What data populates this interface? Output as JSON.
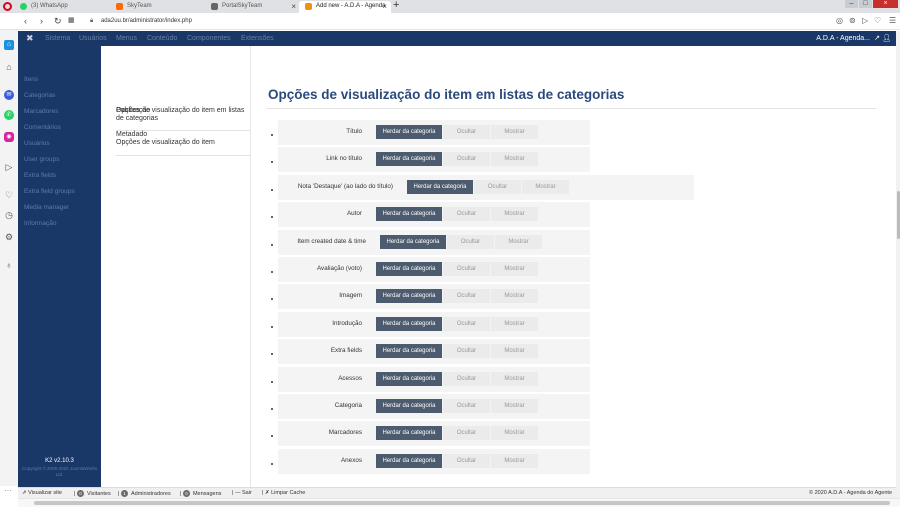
{
  "browser": {
    "tabs": [
      {
        "label": "(3) WhatsApp",
        "color": "#25d366",
        "active": false
      },
      {
        "label": "SkyTeam",
        "color": "#ff6a00",
        "active": false
      },
      {
        "label": "PortalSkyTeam",
        "color": "#666666",
        "active": false
      },
      {
        "label": "Add new - A.D.A - Agenda",
        "color": "#f29111",
        "active": true
      }
    ],
    "url": "ada2uu.br/administrator/index.php"
  },
  "joomla": {
    "menu": [
      "Sistema",
      "Usuários",
      "Menus",
      "Conteúdo",
      "Componentes",
      "Extensões"
    ],
    "site_name": "A.D.A - Agenda..."
  },
  "k2": {
    "nav": [
      "Itens",
      "Categorias",
      "Marcadores",
      "Comentários",
      "Usuários",
      "User groups",
      "Extra fields",
      "Extra field groups",
      "Media manager",
      "Informação"
    ],
    "version": "K2 v2.10.3",
    "copyright": "Copyright © 2006-2020 JoomlaWorks Ltd."
  },
  "tabs_panel": {
    "group1_a": "Publicação",
    "group1_b": "Opções de visualização do item em listas de categorias",
    "group2_a": "Metadado",
    "group2_b": "Opções de visualização do item"
  },
  "main": {
    "title": "Opções de visualização do item em listas de categorias",
    "btn_inherit": "Herdar da categoria",
    "btn_hide": "Ocultar",
    "btn_show": "Mostrar",
    "rows": [
      {
        "label": "Título"
      },
      {
        "label": "Link no título"
      },
      {
        "label": "Nota 'Destaque' (ao lado do título)"
      },
      {
        "label": "Autor"
      },
      {
        "label": "Item created date & time"
      },
      {
        "label": "Avaliação (voto)"
      },
      {
        "label": "Imagem"
      },
      {
        "label": "Introdução"
      },
      {
        "label": "Extra fields"
      },
      {
        "label": "Acessos"
      },
      {
        "label": "Categoria"
      },
      {
        "label": "Marcadores"
      },
      {
        "label": "Anexos"
      }
    ]
  },
  "status": {
    "view_site": "Visualizar site",
    "visitors_count": "0",
    "visitors": "Visitantes",
    "admins_count": "1",
    "admins": "Administradores",
    "messages_count": "0",
    "messages": "Mensagens",
    "logout": "Sair",
    "clear_cache": "Limpar Cache",
    "copyright": "© 2020 A.D.A - Agenda do Agente"
  }
}
